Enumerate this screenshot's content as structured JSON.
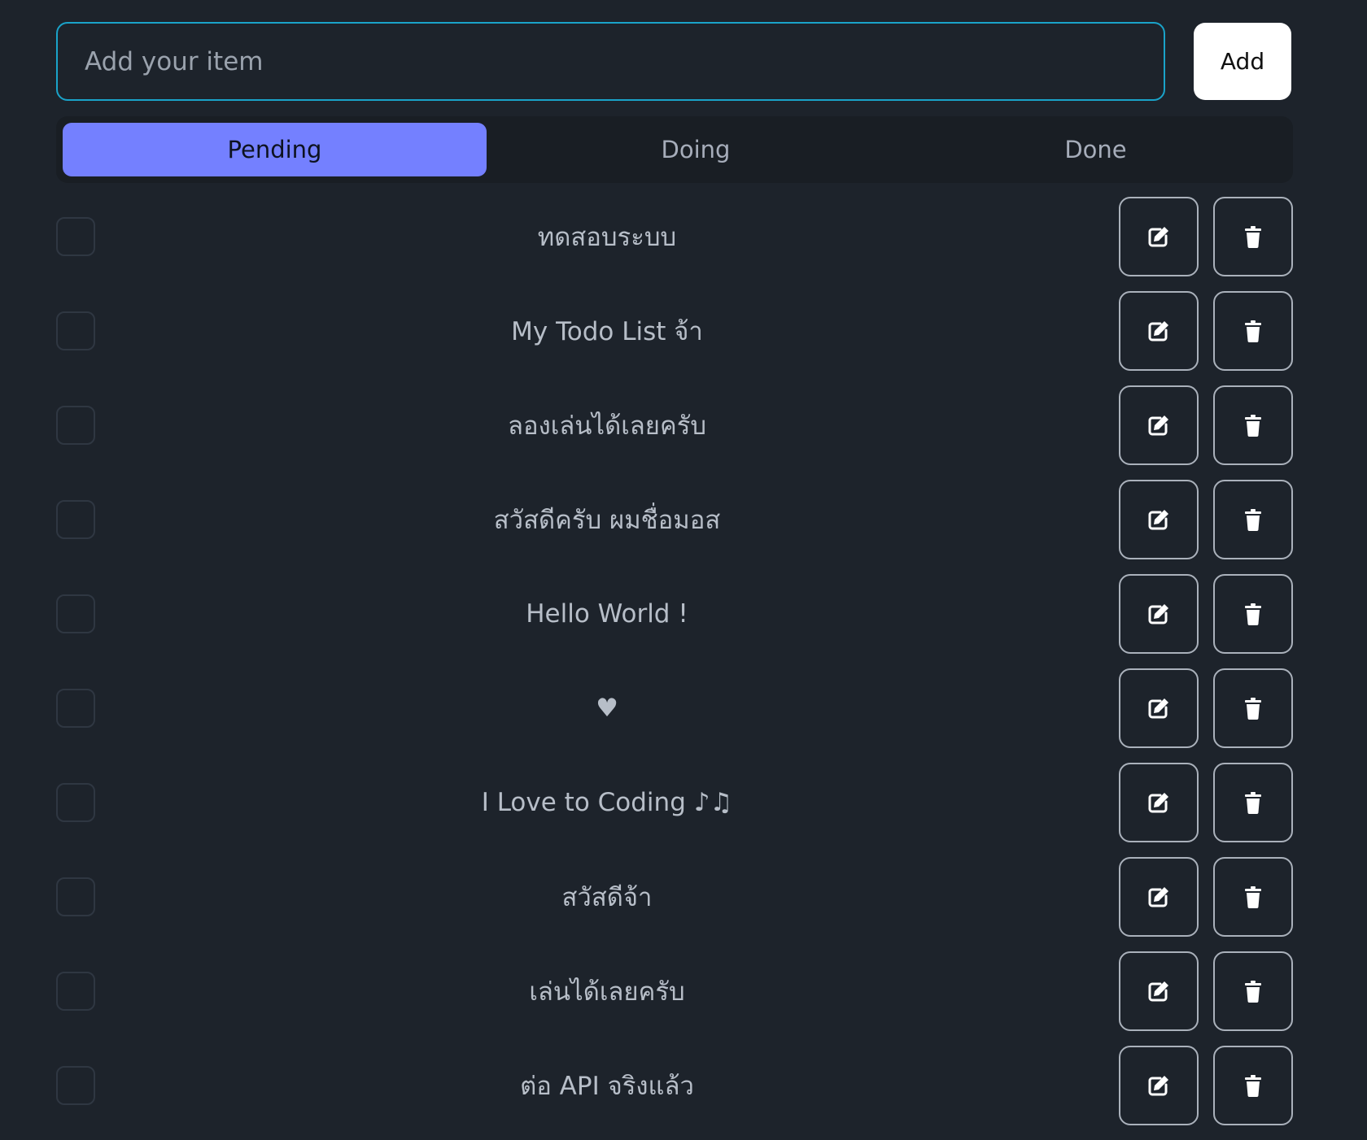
{
  "add_form": {
    "input_value": "",
    "input_placeholder": "Add your item",
    "button_label": "Add"
  },
  "tabs": [
    {
      "label": "Pending",
      "active": true
    },
    {
      "label": "Doing",
      "active": false
    },
    {
      "label": "Done",
      "active": false
    }
  ],
  "todos": [
    {
      "text": "ทดสอบระบบ",
      "checked": false
    },
    {
      "text": "My Todo List จ้า",
      "checked": false
    },
    {
      "text": "ลองเล่นได้เลยครับ",
      "checked": false
    },
    {
      "text": "สวัสดีครับ ผมชื่อมอส",
      "checked": false
    },
    {
      "text": "Hello World !",
      "checked": false
    },
    {
      "text": "♥",
      "checked": false
    },
    {
      "text": "I Love to Coding ♪♫",
      "checked": false
    },
    {
      "text": "สวัสดีจ้า",
      "checked": false
    },
    {
      "text": "เล่นได้เลยครับ",
      "checked": false
    },
    {
      "text": "ต่อ API จริงแล้ว",
      "checked": false
    }
  ],
  "icons": {
    "edit": "pencil-square-icon",
    "delete": "trash-icon"
  },
  "colors": {
    "background": "#1d232b",
    "tab_bar": "#191e24",
    "active_tab": "#7480ff",
    "input_border": "#1aa3c9",
    "add_button": "#ffffff",
    "action_border": "#aab1bb"
  }
}
